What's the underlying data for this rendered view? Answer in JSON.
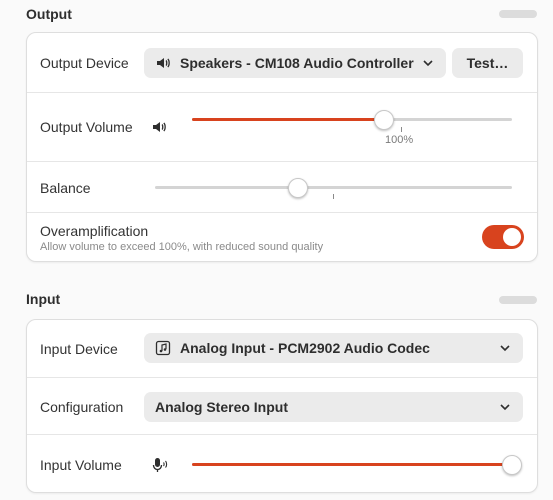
{
  "output": {
    "title": "Output",
    "device": {
      "label": "Output Device",
      "value": "Speakers - CM108 Audio Controller",
      "icon": "speaker-icon",
      "test_label": "Test…"
    },
    "volume": {
      "label": "Output Volume",
      "icon": "speaker-icon",
      "level": 0.6,
      "tick_label": "100%"
    },
    "balance": {
      "label": "Balance",
      "level": 0.4
    },
    "overamplification": {
      "label": "Overamplification",
      "description": "Allow volume to exceed 100%, with reduced sound quality",
      "enabled": true
    }
  },
  "input": {
    "title": "Input",
    "device": {
      "label": "Input Device",
      "value": "Analog Input - PCM2902 Audio Codec",
      "icon": "audio-card-icon"
    },
    "configuration": {
      "label": "Configuration",
      "value": "Analog Stereo Input"
    },
    "volume": {
      "label": "Input Volume",
      "icon": "microphone-icon",
      "level": 1.0
    }
  },
  "colors": {
    "accent": "#d8431e",
    "background": "#fafafa",
    "card": "#ffffff"
  }
}
